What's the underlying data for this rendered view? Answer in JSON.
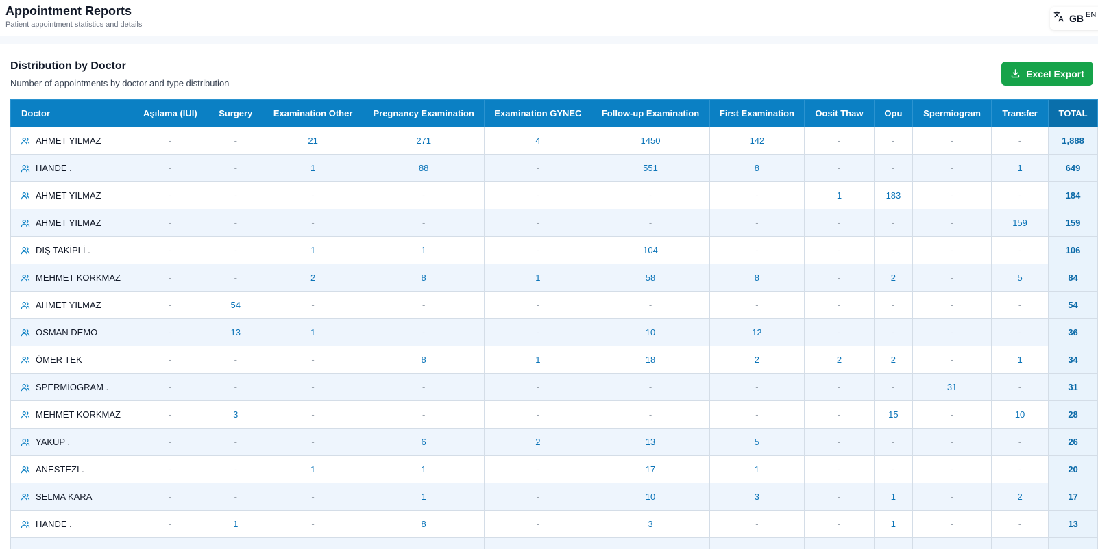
{
  "header": {
    "title": "Appointment Reports",
    "subtitle": "Patient appointment statistics and details",
    "language": {
      "icon": "translate-icon",
      "flag": "GB",
      "code": "EN"
    }
  },
  "section": {
    "title": "Distribution by Doctor",
    "subtitle": "Number of appointments by doctor and type distribution",
    "export_label": "Excel Export",
    "export_color": "#16a34a"
  },
  "table": {
    "header_color": "#0b80c4",
    "columns": [
      "Doctor",
      "Aşılama (IUI)",
      "Surgery",
      "Examination Other",
      "Pregnancy Examination",
      "Examination GYNEC",
      "Follow-up Examination",
      "First Examination",
      "Oosit Thaw",
      "Opu",
      "Spermiogram",
      "Transfer",
      "TOTAL"
    ],
    "rows": [
      [
        "AHMET YILMAZ",
        "-",
        "-",
        "21",
        "271",
        "4",
        "1450",
        "142",
        "-",
        "-",
        "-",
        "-",
        "1,888"
      ],
      [
        "HANDE .",
        "-",
        "-",
        "1",
        "88",
        "-",
        "551",
        "8",
        "-",
        "-",
        "-",
        "1",
        "649"
      ],
      [
        "AHMET YILMAZ",
        "-",
        "-",
        "-",
        "-",
        "-",
        "-",
        "-",
        "1",
        "183",
        "-",
        "-",
        "184"
      ],
      [
        "AHMET YILMAZ",
        "-",
        "-",
        "-",
        "-",
        "-",
        "-",
        "-",
        "-",
        "-",
        "-",
        "159",
        "159"
      ],
      [
        "DIŞ TAKİPLİ .",
        "-",
        "-",
        "1",
        "1",
        "-",
        "104",
        "-",
        "-",
        "-",
        "-",
        "-",
        "106"
      ],
      [
        "MEHMET KORKMAZ",
        "-",
        "-",
        "2",
        "8",
        "1",
        "58",
        "8",
        "-",
        "2",
        "-",
        "5",
        "84"
      ],
      [
        "AHMET YILMAZ",
        "-",
        "54",
        "-",
        "-",
        "-",
        "-",
        "-",
        "-",
        "-",
        "-",
        "-",
        "54"
      ],
      [
        "OSMAN DEMO",
        "-",
        "13",
        "1",
        "-",
        "-",
        "10",
        "12",
        "-",
        "-",
        "-",
        "-",
        "36"
      ],
      [
        "ÖMER TEK",
        "-",
        "-",
        "-",
        "8",
        "1",
        "18",
        "2",
        "2",
        "2",
        "-",
        "1",
        "34"
      ],
      [
        "SPERMİOGRAM .",
        "-",
        "-",
        "-",
        "-",
        "-",
        "-",
        "-",
        "-",
        "-",
        "31",
        "-",
        "31"
      ],
      [
        "MEHMET KORKMAZ",
        "-",
        "3",
        "-",
        "-",
        "-",
        "-",
        "-",
        "-",
        "15",
        "-",
        "10",
        "28"
      ],
      [
        "YAKUP .",
        "-",
        "-",
        "-",
        "6",
        "2",
        "13",
        "5",
        "-",
        "-",
        "-",
        "-",
        "26"
      ],
      [
        "ANESTEZI .",
        "-",
        "-",
        "1",
        "1",
        "-",
        "17",
        "1",
        "-",
        "-",
        "-",
        "-",
        "20"
      ],
      [
        "SELMA KARA",
        "-",
        "-",
        "-",
        "1",
        "-",
        "10",
        "3",
        "-",
        "1",
        "-",
        "2",
        "17"
      ],
      [
        "HANDE .",
        "-",
        "1",
        "-",
        "8",
        "-",
        "3",
        "-",
        "-",
        "1",
        "-",
        "-",
        "13"
      ],
      [
        "",
        "",
        "",
        "",
        "",
        "",
        "",
        "",
        "",
        "",
        "",
        "",
        ""
      ]
    ]
  }
}
